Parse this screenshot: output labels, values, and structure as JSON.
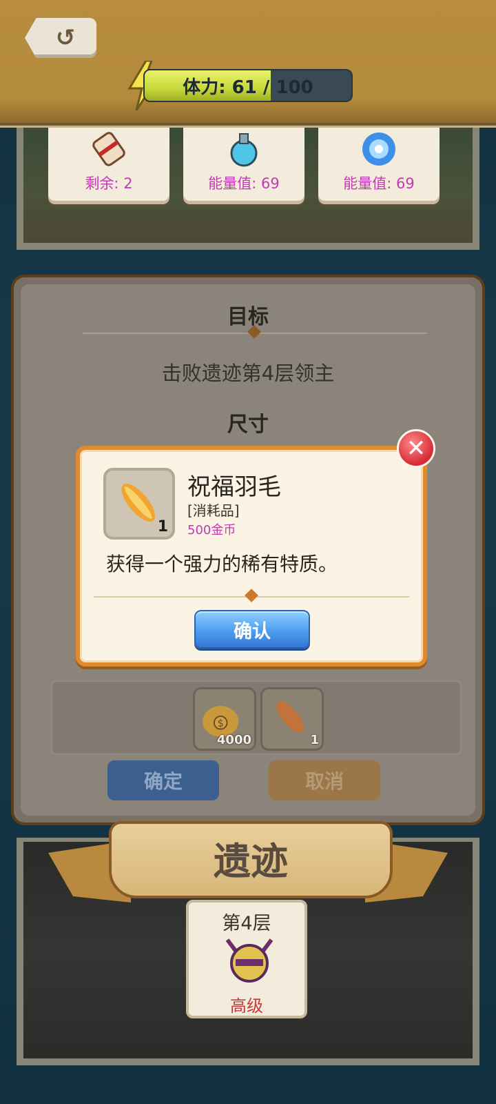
{
  "header": {
    "energy_label": "体力: 61 / 100",
    "energy_current": 61,
    "energy_max": 100
  },
  "items": [
    {
      "label": "剩余: 2",
      "icon": "scroll-icon"
    },
    {
      "label": "能量值: 69",
      "icon": "potion-icon"
    },
    {
      "label": "能量值: 69",
      "icon": "portal-icon"
    }
  ],
  "main": {
    "objective_title": "目标",
    "objective_text": "击败遗迹第4层领主",
    "size_title": "尺寸",
    "rewards": [
      {
        "count": "4000",
        "icon": "gold-bag-icon"
      },
      {
        "count": "1",
        "icon": "feather-icon"
      }
    ],
    "confirm_label": "确定",
    "cancel_label": "取消"
  },
  "ruins": {
    "banner_title": "遗迹",
    "floor": "第4层",
    "level": "高级"
  },
  "popup": {
    "item_name": "祝福羽毛",
    "item_type": "[消耗品]",
    "item_price": "500金币",
    "item_count": "1",
    "description": "获得一个强力的稀有特质。",
    "confirm_label": "确认"
  },
  "colors": {
    "accent_orange": "#e28a2e",
    "price_magenta": "#c23ab2",
    "button_blue": "#4d9df0",
    "close_red": "#d62a35"
  }
}
